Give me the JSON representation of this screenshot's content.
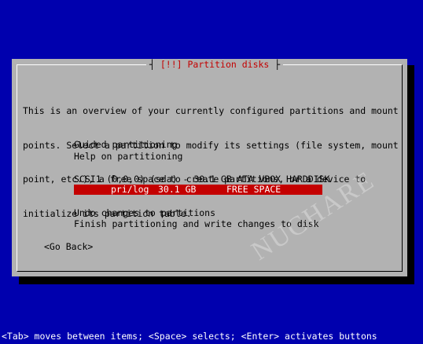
{
  "dialog": {
    "title": "[!!] Partition disks",
    "intro_lines": [
      "This is an overview of your currently configured partitions and mount",
      "points. Select a partition to modify its settings (file system, mount",
      "point, etc.), a free space to create partitions, or a device to",
      "initialize its partition table."
    ],
    "menu": {
      "guided": "Guided partitioning",
      "help": "Help on partitioning",
      "disk": "SCSI1 (0,0,0) (sda) - 30.1 GB ATA VBOX HARDDISK",
      "partition": {
        "type": "pri/log",
        "size": "30.1 GB",
        "label": "FREE SPACE"
      },
      "undo": "Undo changes to partitions",
      "finish": "Finish partitioning and write changes to disk"
    },
    "go_back": "<Go Back>"
  },
  "status_bar": "<Tab> moves between items; <Space> selects; <Enter> activates buttons",
  "watermark": "NUCHARE",
  "colors": {
    "background": "#0000ae",
    "dialog": "#b2b2b2",
    "highlight": "#c40000",
    "title_text": "#c40000"
  }
}
